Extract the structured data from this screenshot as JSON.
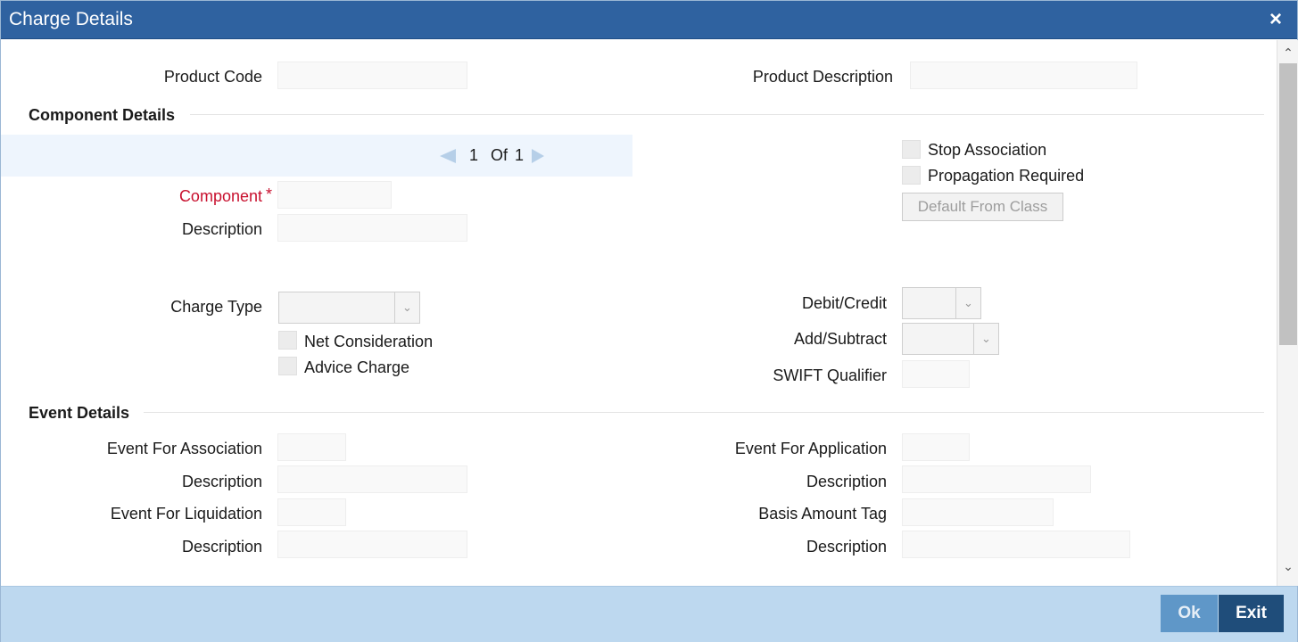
{
  "window": {
    "title": "Charge Details",
    "close_icon": "×"
  },
  "header": {
    "product_code_label": "Product Code",
    "product_code_value": "",
    "product_description_label": "Product Description",
    "product_description_value": ""
  },
  "component_details": {
    "title": "Component Details",
    "pager": {
      "current": "1",
      "of_label": "Of",
      "total": "1"
    },
    "component_label": "Component",
    "required_mark": "*",
    "component_value": "",
    "description_label": "Description",
    "description_value": "",
    "stop_association_label": "Stop Association",
    "propagation_required_label": "Propagation Required",
    "default_from_class_label": "Default From Class",
    "charge_type_label": "Charge Type",
    "charge_type_value": "",
    "net_consideration_label": "Net Consideration",
    "advice_charge_label": "Advice Charge",
    "debit_credit_label": "Debit/Credit",
    "debit_credit_value": "",
    "add_subtract_label": "Add/Subtract",
    "add_subtract_value": "",
    "swift_qualifier_label": "SWIFT Qualifier",
    "swift_qualifier_value": ""
  },
  "event_details": {
    "title": "Event Details",
    "event_for_association_label": "Event For Association",
    "event_for_association_desc_label": "Description",
    "event_for_liquidation_label": "Event For Liquidation",
    "event_for_liquidation_desc_label": "Description",
    "event_for_application_label": "Event For Application",
    "event_for_application_desc_label": "Description",
    "basis_amount_tag_label": "Basis Amount Tag",
    "basis_amount_tag_desc_label": "Description"
  },
  "scrollbar": {
    "up_icon": "chevron-up-icon",
    "down_icon": "chevron-down-icon"
  },
  "footer": {
    "ok_label": "Ok",
    "exit_label": "Exit"
  },
  "colors": {
    "titlebar": "#2f62a0",
    "footer": "#bdd8ef",
    "required": "#c8102e",
    "exit_button": "#1f4d7a",
    "ok_button": "#5f97c8"
  }
}
